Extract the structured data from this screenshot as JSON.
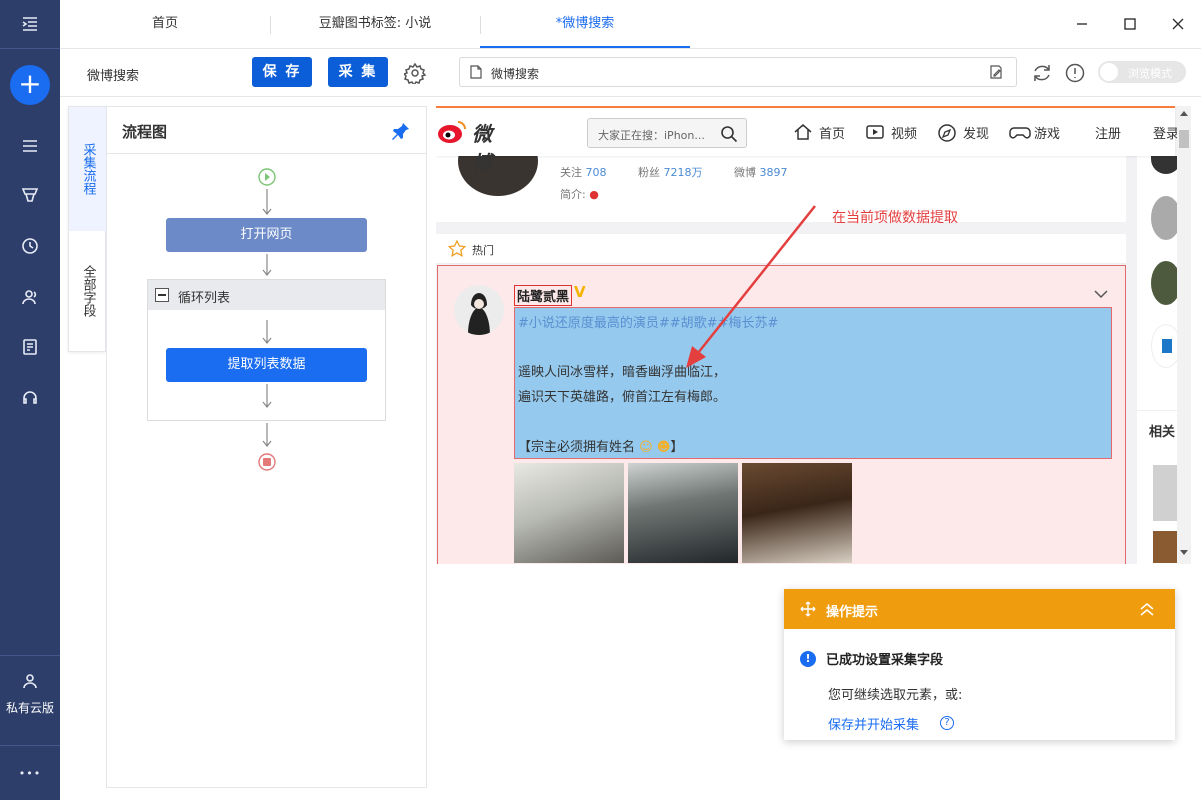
{
  "sidebar": {
    "private_cloud_label": "私有云版",
    "more_label": "•••"
  },
  "tabs": [
    {
      "label": "首页",
      "active": false
    },
    {
      "label": "豆瓣图书标签: 小说",
      "active": false
    },
    {
      "label": "*微博搜索",
      "active": true
    }
  ],
  "toolbar": {
    "task_name": "微博搜索",
    "save_label": "保 存",
    "collect_label": "采 集",
    "url_text": "微博搜索",
    "browse_mode_label": "浏览模式"
  },
  "side_tabs": [
    {
      "label": "采集流程",
      "active": true
    },
    {
      "label": "全部字段",
      "active": false
    }
  ],
  "flow": {
    "title": "流程图",
    "open_page_label": "打开网页",
    "loop_label": "循环列表",
    "extract_label": "提取列表数据"
  },
  "weibo": {
    "logo_text": "微博",
    "search_placeholder": "大家正在搜：iPhon...",
    "nav": [
      "首页",
      "视频",
      "发现",
      "游戏",
      "注册",
      "登录"
    ],
    "stats": {
      "follow_label": "关注",
      "follow_value": "708",
      "fans_label": "粉丝",
      "fans_value": "7218万",
      "weibo_label": "微博",
      "weibo_value": "3897"
    },
    "intro_label": "简介:",
    "hot_label": "热门",
    "post": {
      "author": "陆鹭贰黑",
      "tags": "#小说还原度最高的演员##胡歌##梅长苏#",
      "line1": "遥映人间冰雪样，暗香幽浮曲临江，",
      "line2": "遍识天下英雄路，俯首江左有梅郎。",
      "line3": "【宗主必须拥有姓名"
    },
    "related_label": "相关"
  },
  "annotation": "在当前项做数据提取",
  "tip": {
    "header": "操作提示",
    "title": "已成功设置采集字段",
    "text": "您可继续选取元素，或:",
    "link": "保存并开始采集"
  },
  "colors": {
    "nav_bg": "#2d3e6b",
    "accent": "#1a6cf0",
    "node_open": "#6b8ac7",
    "tip_header": "#f09c0f",
    "annotation": "#e43f3f"
  }
}
